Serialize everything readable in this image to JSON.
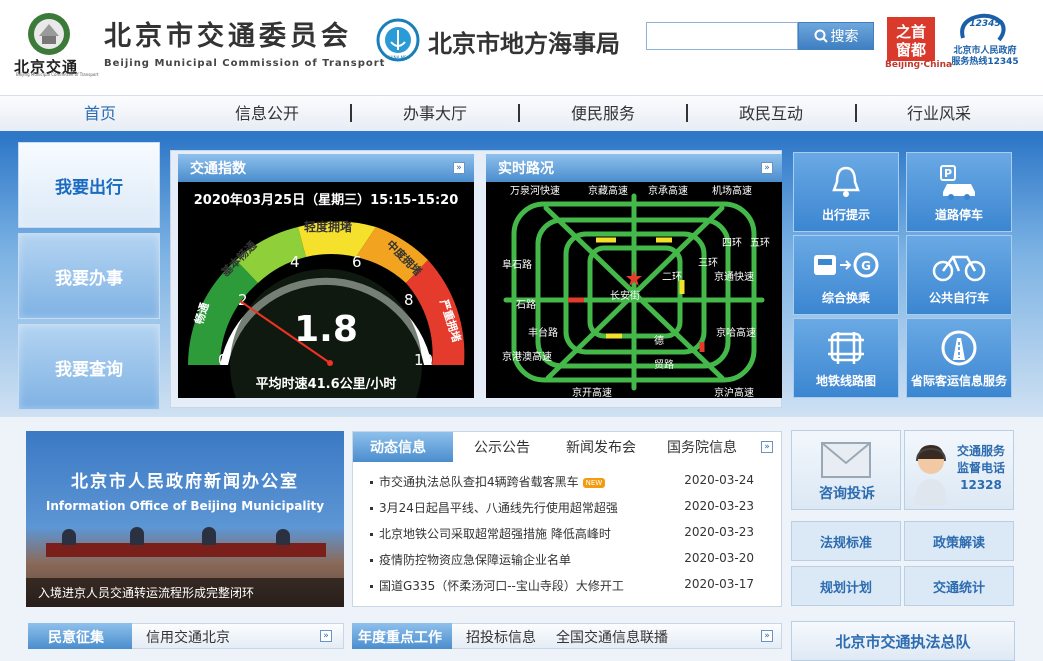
{
  "header": {
    "logo_text": "北京交通",
    "logo_sub": "Beijing Municipal Committee of Transport",
    "comm_title": "北京市交通委员会",
    "comm_en": "Beijing Municipal Commission of Transport",
    "msa_title": "北京市地方海事局",
    "msa_seal": "CHINA MSA",
    "search_placeholder": "",
    "search_label": "搜索",
    "beijing_logo_text": "Beijing·China",
    "hotline_number": "12345",
    "hotline_text1": "北京市人民政府",
    "hotline_text2": "服务热线12345"
  },
  "nav": [
    "首页",
    "信息公开",
    "办事大厅",
    "便民服务",
    "政民互动",
    "行业风采"
  ],
  "left_buttons": [
    "我要出行",
    "我要办事",
    "我要查询"
  ],
  "traffic_index": {
    "title": "交通指数",
    "datetime": "2020年03月25日（星期三）15:15-15:20",
    "value": "1.8",
    "avg_speed": "平均时速41.6公里/小时",
    "levels": [
      "畅通",
      "基本畅通",
      "轻度拥堵",
      "中度拥堵",
      "严重拥堵"
    ],
    "ticks": [
      "0",
      "2",
      "4",
      "6",
      "8",
      "10"
    ]
  },
  "road": {
    "title": "实时路况",
    "labels": [
      "万泉河快速",
      "京藏高速",
      "京承高速",
      "机场高速",
      "四环",
      "五环",
      "二环",
      "三环",
      "阜石路",
      "石路",
      "丰台路",
      "长安街",
      "京通快速",
      "京哈高速",
      "京开高速",
      "京沪高速",
      "京港澳高速",
      "德",
      "贸路"
    ]
  },
  "tiles": [
    {
      "label": "出行提示",
      "icon": "bell-icon"
    },
    {
      "label": "道路停车",
      "icon": "parking-icon"
    },
    {
      "label": "综合换乘",
      "icon": "transfer-icon"
    },
    {
      "label": "公共自行车",
      "icon": "bicycle-icon"
    },
    {
      "label": "地铁线路图",
      "icon": "subway-map-icon"
    },
    {
      "label": "省际客运信息服务",
      "icon": "road-icon"
    }
  ],
  "news_image": {
    "title": "北京市人民政府新闻办公室",
    "subtitle": "Information Office of Beijing Municipality",
    "caption": "入境进京人员交通转运流程形成完整闭环"
  },
  "news_tabs": [
    "动态信息",
    "公示公告",
    "新闻发布会",
    "国务院信息"
  ],
  "news": [
    {
      "title": "市交通执法总队查扣4辆跨省载客黑车",
      "date": "2020-03-24",
      "new": true
    },
    {
      "title": "3月24日起昌平线、八通线先行使用超常超强",
      "date": "2020-03-23",
      "new": false
    },
    {
      "title": "北京地铁公司采取超常超强措施 降低高峰时",
      "date": "2020-03-23",
      "new": false
    },
    {
      "title": "疫情防控物资应急保障运输企业名单",
      "date": "2020-03-20",
      "new": false
    },
    {
      "title": "国道G335（怀柔汤河口--宝山寺段）大修开工",
      "date": "2020-03-17",
      "new": false
    }
  ],
  "new_badge": "NEW",
  "right": {
    "complaint": "咨询投诉",
    "hotline_title1": "交通服务",
    "hotline_title2": "监督电话",
    "hotline_number": "12328",
    "cards": [
      "法规标准",
      "政策解读",
      "规划计划",
      "交通统计"
    ],
    "enforcement": "北京市交通执法总队"
  },
  "bottom_tabs_left": [
    "民意征集",
    "信用交通北京"
  ],
  "bottom_tabs_mid": [
    "年度重点工作",
    "招投标信息",
    "全国交通信息联播"
  ],
  "more_symbol": "»"
}
